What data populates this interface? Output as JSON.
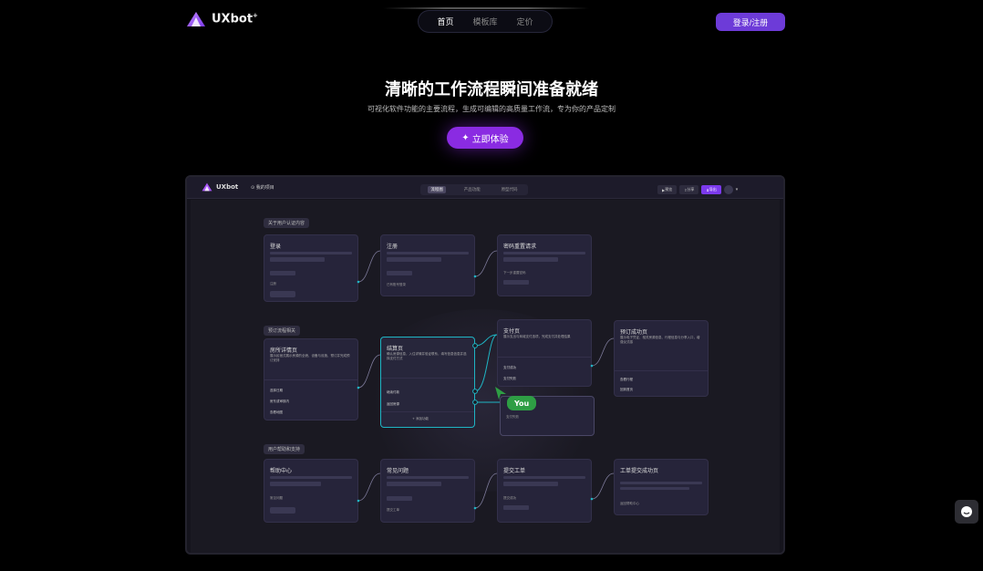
{
  "brand": {
    "name": "UXbot",
    "mark": "+"
  },
  "nav": {
    "items": [
      "首页",
      "模板库",
      "定价"
    ],
    "active_index": 0
  },
  "login_label": "登录/注册",
  "hero": {
    "title": "清晰的工作流程瞬间准备就绪",
    "subtitle": "可视化软件功能的主要流程，生成可编辑的高质量工作流，专为你的产品定制",
    "cta_label": "立即体验",
    "cta_icon": "sparkle-icon"
  },
  "preview": {
    "brand": "UXbot",
    "project": "我的项目",
    "tabs": [
      "流程图",
      "产品功能",
      "原型代码"
    ],
    "active_tab": 0,
    "actions": [
      "预览",
      "分享",
      "导出"
    ],
    "sections": {
      "auth": "关于用户认证内容",
      "booking": "预订流程相关",
      "help": "用户帮助和支持"
    },
    "cards": {
      "login": {
        "title": "登录",
        "link": "注册"
      },
      "register": {
        "title": "注册",
        "link": "已有账号登录"
      },
      "reset": {
        "title": "密码重置请求",
        "link": "下一步重置密码"
      },
      "detail": {
        "title": "房所详情页",
        "desc": "展示民宿式展示房源的全貌、设备与设施、预订并完成预订安排",
        "links": [
          "选择日期",
          "房东或审核内",
          "查看地图"
        ]
      },
      "checkout": {
        "title": "结算页",
        "desc": "确认房源信息，入住详情并验证联系，填写信息信息并选择支付方式",
        "links": [
          "继续付款",
          "返回房源"
        ],
        "add_node": "添加功能"
      },
      "payment": {
        "title": "支付页",
        "desc": "展示支出与商城支付选项，完成支付并处理结果",
        "links": [
          "支付成功",
          "支付失败"
        ]
      },
      "payment_failed": {
        "desc": "支付失败"
      },
      "booking_success": {
        "title": "预订成功页",
        "desc": "展示电子凭证、相关房源信息、行程信息与分享入口，增强仪式感",
        "links": [
          "查看行程",
          "回到首页"
        ]
      },
      "help_center": {
        "title": "帮助中心",
        "link": "常见问题"
      },
      "faq": {
        "title": "常见问题",
        "link": "提交工单"
      },
      "ticket": {
        "title": "提交工单",
        "link": "提交成功"
      },
      "ticket_success": {
        "title": "工单提交成功页",
        "link": "返回帮助中心"
      }
    },
    "cursor_label": "You"
  },
  "colors": {
    "accent": "#6d3bd8",
    "cta": "#8a2be2",
    "highlight_wire": "#1fb5c4",
    "cursor": "#2e9e44"
  }
}
